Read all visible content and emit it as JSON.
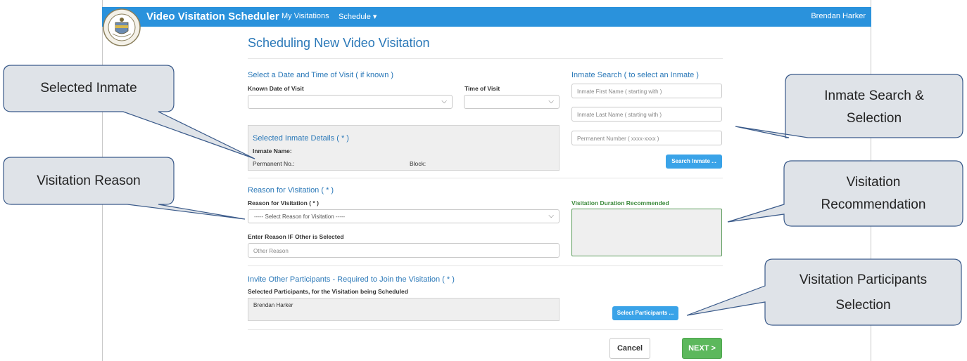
{
  "app": {
    "title": "Video Visitation Scheduler",
    "nav": {
      "my_visitations": "My Visitations",
      "schedule": "Schedule ▾"
    },
    "user": "Brendan Harker"
  },
  "page": {
    "title": "Scheduling New Video Visitation"
  },
  "date_time": {
    "heading": "Select a Date and Time of Visit ( if known )",
    "date_label": "Known Date of Visit",
    "time_label": "Time of Visit",
    "date_value": "",
    "time_value": ""
  },
  "inmate_search": {
    "heading": "Inmate Search ( to select an Inmate )",
    "first_name_placeholder": "Inmate First Name ( starting with )",
    "last_name_placeholder": "Inmate Last Name ( starting with )",
    "permanent_placeholder": "Permanent Number ( xxxx-xxxx )",
    "search_button": "Search Inmate ..."
  },
  "selected_inmate": {
    "heading": "Selected Inmate Details ( * )",
    "name_label": "Inmate Name:",
    "permanent_label": "Permanent No.:",
    "block_label": "Block:"
  },
  "reason": {
    "heading": "Reason for Visitation ( * )",
    "label": "Reason for Visitation ( * )",
    "selected": "----- Select Reason for Visitation -----",
    "other_label": "Enter Reason IF Other is Selected",
    "other_placeholder": "Other Reason",
    "duration_label": "Visitation Duration Recommended"
  },
  "participants": {
    "heading": "Invite Other Participants - Required to Join the Visitation ( * )",
    "label": "Selected Participants, for the Visitation being Scheduled",
    "selected": "Brendan Harker",
    "select_button": "Select Participants ..."
  },
  "actions": {
    "cancel": "Cancel",
    "next": "NEXT >"
  },
  "callouts": {
    "selected_inmate": "Selected Inmate",
    "visitation_reason": "Visitation Reason",
    "inmate_search_1": "Inmate Search &",
    "inmate_search_2": "Selection",
    "recommendation_1": "Visitation",
    "recommendation_2": "Recommendation",
    "participants_1": "Visitation Participants",
    "participants_2": "Selection"
  },
  "colors": {
    "navbar": "#2a92dc",
    "heading": "#2a78b8",
    "next": "#5cb85c",
    "search_button": "#3aa3e8",
    "callout_fill": "#dfe3e8"
  }
}
